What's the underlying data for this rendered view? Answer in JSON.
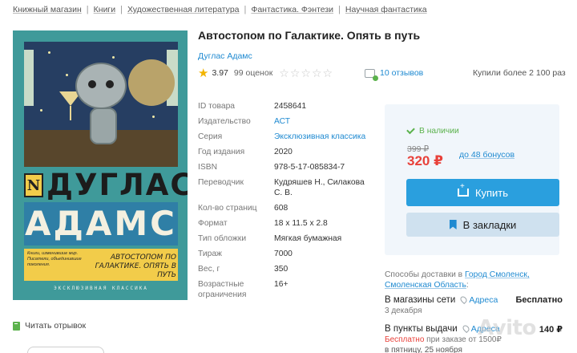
{
  "breadcrumbs": [
    "Книжный магазин",
    "Книги",
    "Художественная литература",
    "Фантастика. Фэнтези",
    "Научная фантастика"
  ],
  "cover": {
    "publisher_mark": "N",
    "author_first": "ДУГЛАС",
    "author_last": "АДАМС",
    "blurb": "Книги, изменившие мир. Писатели, объединившие поколения.",
    "title": "АВТОСТОПОМ ПО ГАЛАКТИКЕ. ОПЯТЬ В ПУТЬ",
    "series": "ЭКСКЛЮЗИВНАЯ КЛАССИКА"
  },
  "excerpt_label": "Читать отрывок",
  "product": {
    "title": "Автостопом по Галактике. Опять в путь",
    "author": "Дуглас Адамс",
    "rating": "3.97",
    "ratings_count": "99 оценок",
    "user_stars": 5,
    "reviews": "10 отзывов",
    "bought": "Купили более 2 100 раз"
  },
  "specs": [
    {
      "key": "ID товара",
      "value": "2458641",
      "link": false
    },
    {
      "key": "Издательство",
      "value": "АСТ",
      "link": true
    },
    {
      "key": "Серия",
      "value": "Эксклюзивная классика",
      "link": true
    },
    {
      "key": "Год издания",
      "value": "2020",
      "link": false
    },
    {
      "key": "ISBN",
      "value": "978-5-17-085834-7",
      "link": false
    },
    {
      "key": "Переводчик",
      "value": "Кудряшев Н., Силакова С. В.",
      "link": false
    },
    {
      "key": "Кол-во страниц",
      "value": "608",
      "link": false
    },
    {
      "key": "Формат",
      "value": "18 x 11.5 x 2.8",
      "link": false
    },
    {
      "key": "Тип обложки",
      "value": "Мягкая бумажная",
      "link": false
    },
    {
      "key": "Тираж",
      "value": "7000",
      "link": false
    },
    {
      "key": "Вес, г",
      "value": "350",
      "link": false
    },
    {
      "key": "Возрастные ограничения",
      "value": "16+",
      "link": false
    }
  ],
  "buy": {
    "availability": "В наличии",
    "old_price": "399 ₽",
    "price": "320 ₽",
    "bonus": "до 48 бонусов",
    "buy_label": "Купить",
    "bookmark_label": "В закладки"
  },
  "delivery": {
    "head_prefix": "Способы доставки в",
    "head_city": "Город Смоленск, Смоленская Область",
    "head_suffix": ":",
    "rows": [
      {
        "label": "В магазины сети",
        "loc": "Адреса",
        "price": "Бесплатно",
        "sub": "3 декабря"
      },
      {
        "label": "В пункты выдачи",
        "loc": "Адреса",
        "price": "140 ₽",
        "sub_red": "Бесплатно",
        "sub_rest": " при заказе от 1500₽",
        "sub2": "в пятницу, 25 ноября"
      }
    ]
  },
  "watermark": "Avito",
  "colors": {
    "link": "#1f8ad1",
    "accent_button": "#2a9fde",
    "price_red": "#e8413a",
    "in_stock_green": "#5bb24c",
    "star": "#f2b400"
  }
}
